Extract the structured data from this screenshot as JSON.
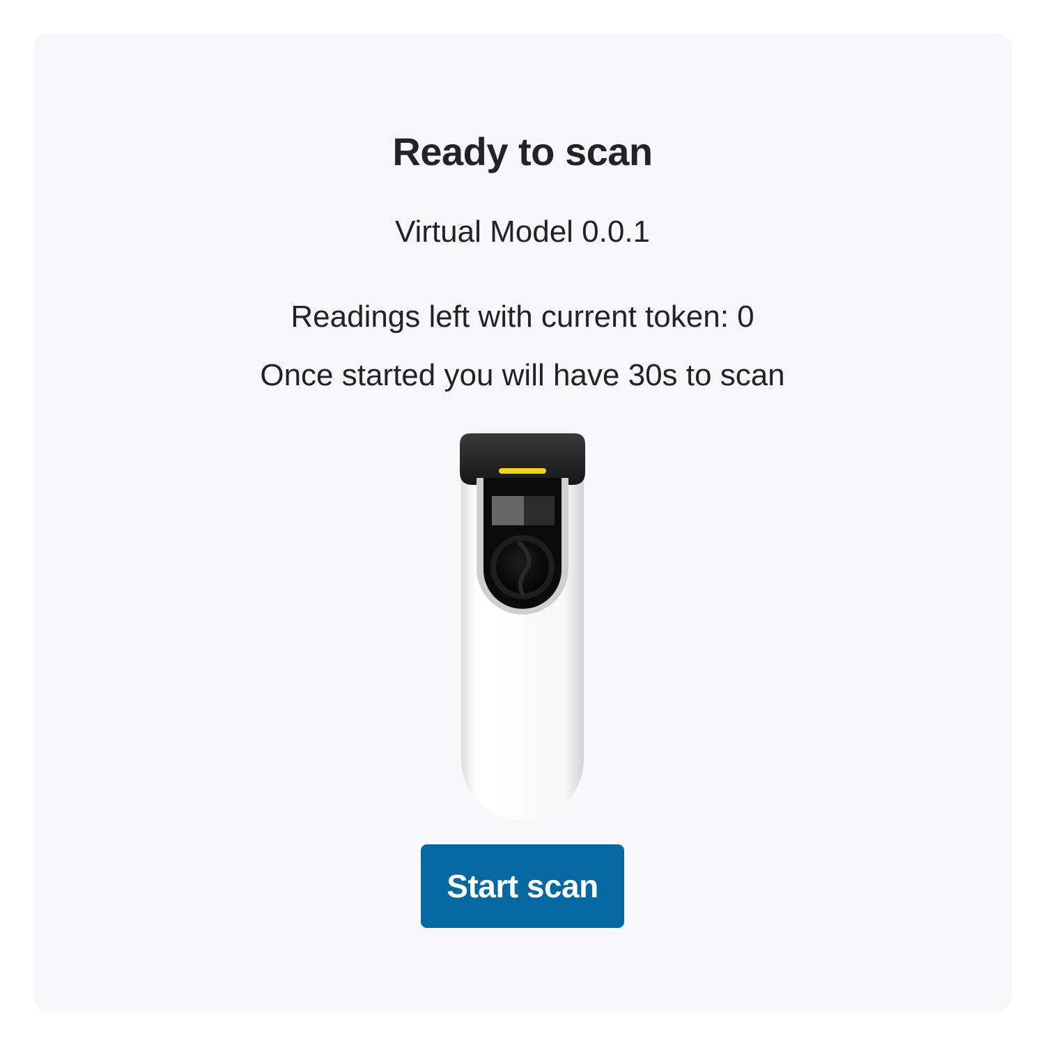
{
  "status": {
    "title": "Ready to scan",
    "model": "Virtual Model 0.0.1",
    "readings": "Readings left with current token: 0",
    "duration": "Once started you will have 30s to scan"
  },
  "device": {
    "icon": "fingerprint-scanner-device",
    "led_color": "#f2d21b"
  },
  "actions": {
    "start_label": "Start scan"
  },
  "colors": {
    "accent": "#0568a0",
    "card_background": "#f8f8fa",
    "text": "#222326"
  }
}
